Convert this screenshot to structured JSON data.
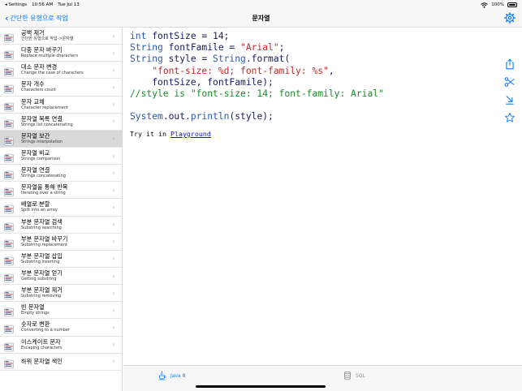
{
  "status_bar": {
    "back_app": "◂ Settings",
    "time": "10:56 AM",
    "date": "Tue Jul 13",
    "battery_percent": "100%"
  },
  "nav": {
    "back_label": "간단한 유형으로 작업",
    "title": "문자열"
  },
  "sidebar": {
    "items": [
      {
        "title": "공백 제거",
        "subtitle": "간단한 유형으로 작업->문자열"
      },
      {
        "title": "다중 문자 바꾸기",
        "subtitle": "Replace multiple characters"
      },
      {
        "title": "대소 문자 변경",
        "subtitle": "Change the case of characters"
      },
      {
        "title": "문자 개수",
        "subtitle": "Characters count"
      },
      {
        "title": "문자 교체",
        "subtitle": "Character replacement"
      },
      {
        "title": "문자열 목록 연결",
        "subtitle": "Strings list concatenating"
      },
      {
        "title": "문자열 보간",
        "subtitle": "Strings interpolation"
      },
      {
        "title": "문자열 비교",
        "subtitle": "Strings comparison"
      },
      {
        "title": "문자열 연결",
        "subtitle": "Strings concatenating"
      },
      {
        "title": "문자열을 통해 반복",
        "subtitle": "Iterating over a string"
      },
      {
        "title": "배열로 분할",
        "subtitle": "Split into an array"
      },
      {
        "title": "부분 문자열 검색",
        "subtitle": "Substring searching"
      },
      {
        "title": "부분 문자열 바꾸기",
        "subtitle": "Substring replacement"
      },
      {
        "title": "부분 문자열 삽입",
        "subtitle": "Substring inserting"
      },
      {
        "title": "부분 문자열 얻기",
        "subtitle": "Getting substring"
      },
      {
        "title": "부분 문자열 제거",
        "subtitle": "Substring removing"
      },
      {
        "title": "빈 문자열",
        "subtitle": "Empty strings"
      },
      {
        "title": "숫자로 변환",
        "subtitle": "Converting to a number"
      },
      {
        "title": "이스케이프 문자",
        "subtitle": "Escaping characters"
      },
      {
        "title": "하위 문자열 색인",
        "subtitle": ""
      }
    ],
    "selected_index": 6
  },
  "code": {
    "l1_kw": "int",
    "l1_rest": " fontSize = 14;",
    "l2_kw": "String",
    "l2_mid": " fontFamile = ",
    "l2_str": "\"Arial\"",
    "l2_end": ";",
    "l3_kw1": "String",
    "l3_mid": " style = ",
    "l3_kw2": "String",
    "l3_end": ".format(",
    "l4_indent": "    ",
    "l4_str": "\"font-size: %d; font-family: %s\"",
    "l4_end": ",",
    "l5": "    fontSize, fontFamile);",
    "l6_comment": "//style is \"font-size: 14; font-family: Arial\"",
    "l8_kw": "System",
    "l8_mid": ".out.",
    "l8_kw2": "println",
    "l8_end": "(style);"
  },
  "try_it": {
    "prefix": "Try it in ",
    "link": "Playground"
  },
  "tabs": {
    "java": "Java 8",
    "sql": "SQL"
  },
  "colors": {
    "accent": "#0a7aff",
    "keyword": "#2a58b4",
    "string": "#c22a2a",
    "comment": "#1b8a28",
    "selected_row": "#d9d9d9"
  }
}
